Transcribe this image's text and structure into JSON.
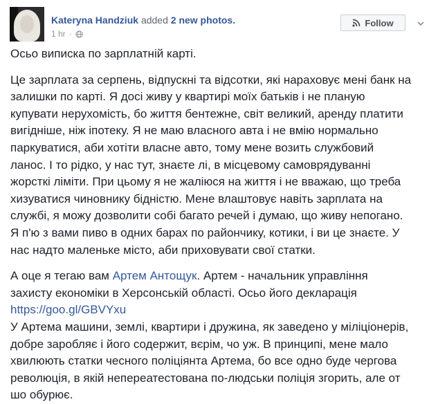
{
  "post": {
    "author": "Kateryna Handziuk",
    "action": "added",
    "photos_link": "2 new photos.",
    "time": "1 hr",
    "follow_label": "Follow",
    "paragraphs": {
      "p1": "Осьо виписка по зарплатній карті.",
      "p2": "Це зарплата за серпень, відпускні та відсотки, які нараховує мені банк на залишки по карті. Я досі живу у квартирі моїх батьків і не планую купувати нерухомість, бо життя бентежне, світ великий, аренду платити вигідніше, ніж іпотеку. Я не маю власного авта і не вмію нормально паркуватися, аби хотіти власне авто, тому мене возить службовий ланос. І то рідко, у нас тут, знаєте лі, в місцевому самоврядуванні жорсткі ліміти. При цьому я не жаліюся на життя і не вважаю, що треба хизуватися чиновнику бідністю. Мене влаштовує навіть зарплата на службі, я можу дозволити собі багато речей і думаю, що живу непогано. Я п'ю з вами пиво в одних барах по райончику, котики, і ви це знаєте. У нас надто маленьке місто, аби приховувати свої статки.",
      "p3_before": "А оце я тегаю вам ",
      "p3_tag": "Артем Антощук",
      "p3_after": ". Артем - начальник управління захисту економіки в Херсонській області. Осьо його декларація",
      "p3_url": "https://goo.gl/GBVYxu",
      "p4": "У Артема машини, землі, квартири і дружина, як заведено у міліціонерів, добре заробляє і його содержит, вєрім, чо уж. В принципі, мене мало хвилюють статки чесного поліціянта Артема, бо все одно буде чергова революція, в якій непереатестована по-людськи поліція згорить, але от шо обурює."
    }
  },
  "icons": {
    "globe": "globe-icon",
    "follow": "rss-icon",
    "menu": "chevron-down-icon"
  },
  "colors": {
    "link": "#365899",
    "text": "#1d2129",
    "meta": "#90949c"
  }
}
